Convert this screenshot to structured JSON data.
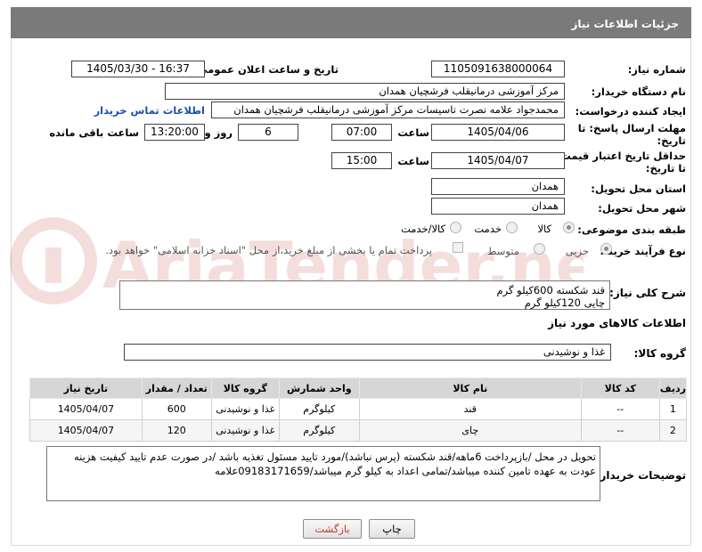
{
  "header": {
    "title": "جزئیات اطلاعات نیاز"
  },
  "fields": {
    "need_number": {
      "label": "شماره نیاز:",
      "value": "1105091638000064"
    },
    "announce": {
      "label": "تاریخ و ساعت اعلان عمومی:",
      "value": "1405/03/30 - 16:37"
    },
    "buyer_org": {
      "label": "نام دستگاه خریدار:",
      "value": "مرکز آموزشی درمانیقلب فرشچیان همدان"
    },
    "requester": {
      "label": "ایجاد کننده درخواست:",
      "value": "محمدجواد علامه نصرت تاسیسات مرکز آموزشی درمانیقلب فرشچیان همدان",
      "contact_link": "اطلاعات تماس خریدار"
    },
    "send_deadline": {
      "label_line1": "مهلت ارسال پاسخ: تا",
      "label_line2": "تاریخ:",
      "date": "1405/04/06",
      "time_label": "ساعت",
      "time": "07:00",
      "days": "6",
      "days_label": "روز و",
      "remaining": "13:20:00",
      "remaining_label": "ساعت باقی مانده"
    },
    "price_validity": {
      "label_line1": "حداقل تاریخ اعتبار قیمت:",
      "label_line2": "تا تاریخ:",
      "date": "1405/04/07",
      "time_label": "ساعت",
      "time": "15:00"
    },
    "province": {
      "label": "استان محل تحویل:",
      "value": "همدان"
    },
    "city": {
      "label": "شهر محل تحویل:",
      "value": "همدان"
    },
    "category": {
      "label": "طبقه بندی موضوعی:",
      "options": [
        "کالا",
        "خدمت",
        "کالا/خدمت"
      ],
      "selected": "کالا"
    },
    "purchase_type": {
      "label": "نوع فرآیند خرید :",
      "options": [
        "جزیی",
        "متوسط"
      ],
      "selected": "جزیی",
      "treasury_note": "پرداخت تمام یا بخشی از مبلغ خرید،از محل \"اسناد خزانه اسلامی\" خواهد بود."
    }
  },
  "general_description": {
    "label": "شرح کلی نیاز:",
    "line1": "قند  شکسته 600کیلو گرم",
    "line2": "چایی        120کیلو گرم"
  },
  "goods_info": {
    "title": "اطلاعات کالاهای مورد نیاز"
  },
  "goods_group": {
    "label": "گروه کالا:",
    "value": "غذا و نوشیدنی"
  },
  "table": {
    "headers": [
      "ردیف",
      "کد کالا",
      "نام کالا",
      "واحد شمارش",
      "گروه کالا",
      "تعداد / مقدار",
      "تاریخ نیاز"
    ],
    "rows": [
      [
        "1",
        "--",
        "قند",
        "کیلوگرم",
        "غذا و نوشیدنی",
        "600",
        "1405/04/07"
      ],
      [
        "2",
        "--",
        "چای",
        "کیلوگرم",
        "غذا و نوشیدنی",
        "120",
        "1405/04/07"
      ]
    ]
  },
  "buyer_notes": {
    "label": "توضیحات خریدار:",
    "line1": "تحویل در محل /بازپرداخت 6ماهه/قند شکسته  (پرس نباشد)/مورد تایید مسئول تغذیه باشد /در صورت عدم تایید کیفیت هزینه",
    "line2": "عودت به عهده تامین کننده میباشد/تمامی اعداد به کیلو گرم میباشد/09183171659علامه"
  },
  "buttons": {
    "print": "چاپ",
    "back": "بازگشت"
  },
  "watermark": {
    "text": "AriaTender.net"
  }
}
